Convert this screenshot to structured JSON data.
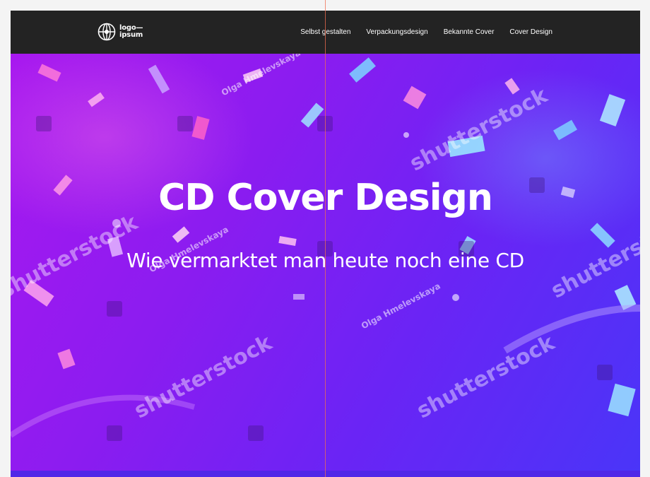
{
  "header": {
    "logo_line1": "logo—",
    "logo_line2": "ipsum",
    "nav": [
      "Selbst gestalten",
      "Verpackungsdesign",
      "Bekannte Cover",
      "Cover Design"
    ]
  },
  "hero": {
    "title": "CD Cover Design",
    "subtitle": "Wie vermarktet man heute noch eine CD",
    "watermark": "shutterstock",
    "watermark_author": "Olga Hmelevskaya"
  },
  "colors": {
    "header_bg": "#232323",
    "hero_start": "#a818ef",
    "hero_end": "#4a35f8",
    "guide": "#f06e50"
  }
}
